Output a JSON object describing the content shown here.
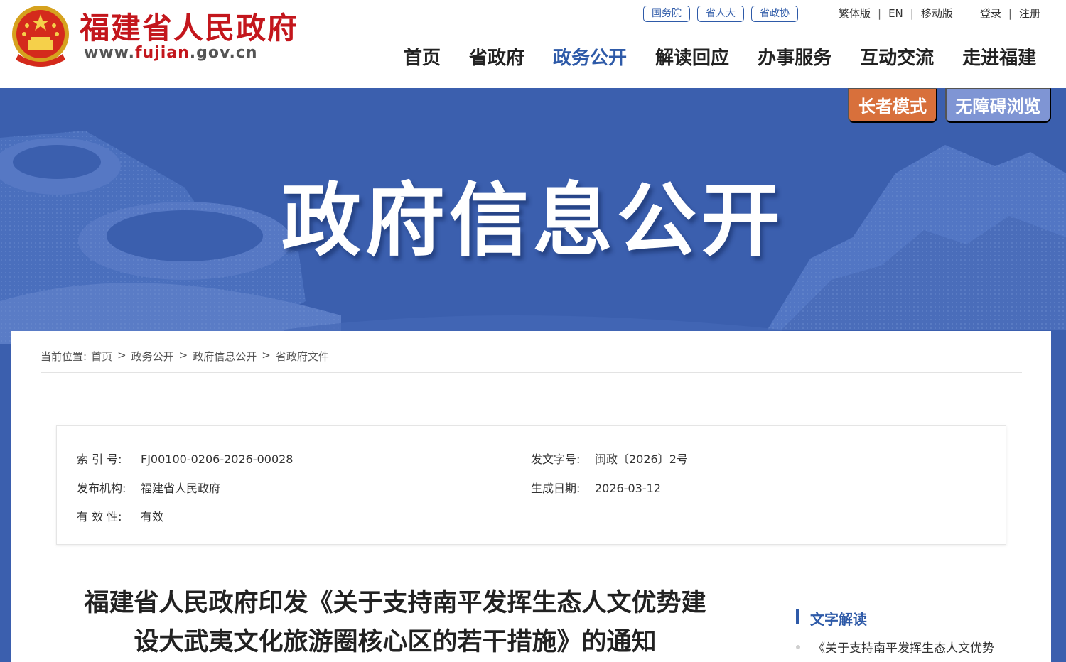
{
  "header": {
    "site_name": "福建省人民政府",
    "url_prefix": "www.",
    "url_highlight": "fujian",
    "url_suffix": ".gov.cn",
    "quick_links": [
      "国务院",
      "省人大",
      "省政协"
    ],
    "util_links": [
      "繁体版",
      "EN",
      "移动版"
    ],
    "account_links": [
      "登录",
      "注册"
    ],
    "separator": "|",
    "nav": [
      "首页",
      "省政府",
      "政务公开",
      "解读回应",
      "办事服务",
      "互动交流",
      "走进福建"
    ],
    "nav_active_index": 2
  },
  "banner": {
    "title": "政府信息公开",
    "elder_mode": "长者模式",
    "accessibility_mode": "无障碍浏览"
  },
  "breadcrumb": {
    "prefix": "当前位置:",
    "items": [
      "首页",
      "政务公开",
      "政府信息公开",
      "省政府文件"
    ],
    "separator": ">"
  },
  "meta": {
    "index_label": "索 引 号:",
    "index_value": "FJ00100-0206-2026-00028",
    "doc_no_label": "发文字号:",
    "doc_no_value": "闽政〔2026〕2号",
    "issuer_label": "发布机构:",
    "issuer_value": "福建省人民政府",
    "date_label": "生成日期:",
    "date_value": "2026-03-12",
    "validity_label": "有 效 性:",
    "validity_value": "有效"
  },
  "document": {
    "title_line1": "福建省人民政府印发《关于支持南平发挥生态人文优势建",
    "title_line2": "设大武夷文化旅游圈核心区的若干措施》的通知"
  },
  "sidebar": {
    "heading": "文字解读",
    "items": [
      "《关于支持南平发挥生态人文优势"
    ]
  },
  "colors": {
    "brand_red": "#c3161c",
    "primary_blue": "#2e5aa8",
    "banner_blue": "#3b5fae",
    "elder_orange": "#d8703b",
    "access_blue": "#7f95d4"
  }
}
